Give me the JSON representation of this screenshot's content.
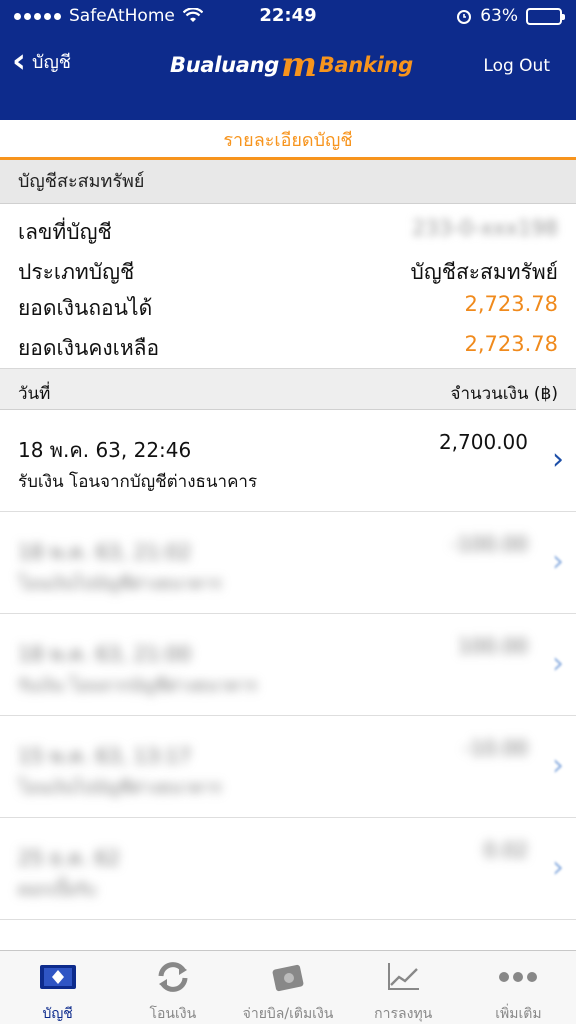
{
  "status": {
    "carrier": "SafeAtHome",
    "time": "22:49",
    "battery": "63%",
    "battery_level": 0.63
  },
  "nav": {
    "back_label": "บัญชี",
    "logo_left": "Bualuang",
    "logo_right": "Banking",
    "logout": "Log Out"
  },
  "page": {
    "title": "รายละเอียดบัญชี",
    "account_type_header": "บัญชีสะสมทรัพย์"
  },
  "account": {
    "number_label": "เลขที่บัญชี",
    "number_value": "233-0-xxx198",
    "type_label": "ประเภทบัญชี",
    "type_value": "บัญชีสะสมทรัพย์",
    "withdrawable_label": "ยอดเงินถอนได้",
    "withdrawable_value": "2,723.78",
    "balance_label": "ยอดเงินคงเหลือ",
    "balance_value": "2,723.78"
  },
  "table": {
    "date_header": "วันที่",
    "amount_header": "จำนวนเงิน (฿)"
  },
  "transactions": [
    {
      "date": "18 พ.ค. 63, 22:46",
      "desc": "รับเงิน โอนจากบัญชีต่างธนาคาร",
      "amount": "2,700.00"
    },
    {
      "date": "18 พ.ค. 63, 21:02",
      "desc": "โอนเงินไปบัญชีต่างธนาคาร",
      "amount": "-100.00"
    },
    {
      "date": "18 พ.ค. 63, 21:00",
      "desc": "รับเงิน โอนจากบัญชีต่างธนาคาร",
      "amount": "100.00"
    },
    {
      "date": "15 พ.ค. 63, 13:17",
      "desc": "โอนเงินไปบัญชีต่างธนาคาร",
      "amount": "-10.00"
    },
    {
      "date": "25 ธ.ค. 62",
      "desc": "ดอกเบี้ยรับ",
      "amount": "0.02"
    }
  ],
  "tabs": [
    {
      "label": "บัญชี",
      "icon": "account-icon"
    },
    {
      "label": "โอนเงิน",
      "icon": "transfer-icon"
    },
    {
      "label": "จ่ายบิล/เติมเงิน",
      "icon": "bill-icon"
    },
    {
      "label": "การลงทุน",
      "icon": "invest-chart-icon"
    },
    {
      "label": "เพิ่มเติม",
      "icon": "more-icon"
    }
  ],
  "colors": {
    "header": "#0d2b8c",
    "accent": "#f7941d",
    "active_tab": "#0d2b8c"
  }
}
